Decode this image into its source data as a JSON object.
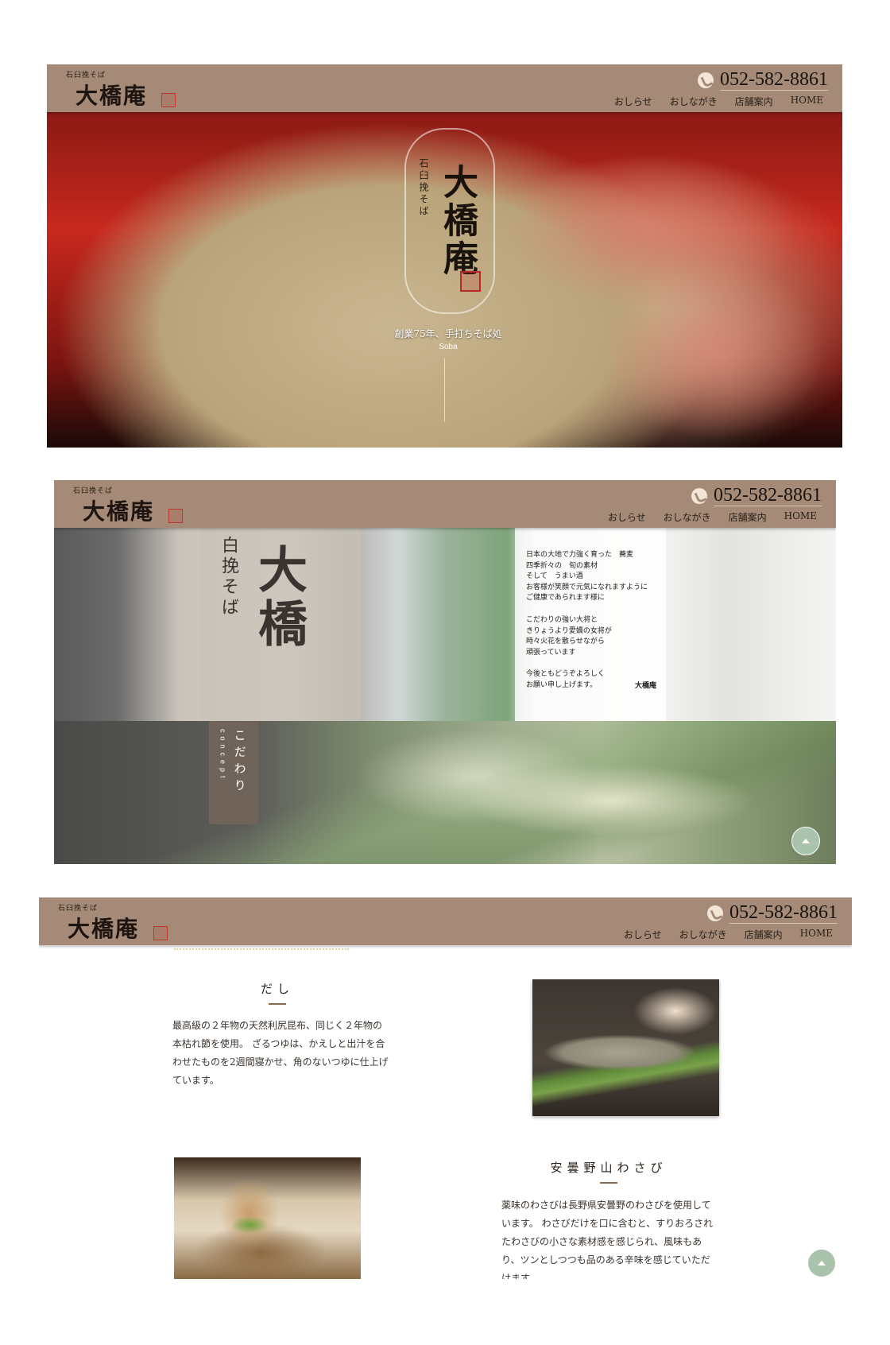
{
  "header": {
    "logo_small": "石臼挽そば",
    "logo_name": "大橋庵",
    "phone": "052-582-8861",
    "nav": [
      "おしらせ",
      "おしながき",
      "店舗案内",
      "HOME"
    ]
  },
  "hero": {
    "crest_sub": "石臼挽そば",
    "crest_name": "大橋庵",
    "tagline": "創業75年、手打ちそば処",
    "soba": "Soba"
  },
  "concept": {
    "sign_small": "白挽そば",
    "sign_big": "大橋",
    "message_paragraphs": [
      "日本の大地で力強く育った　蕎麦\n四季折々の　旬の素材\nそして　うまい酒\nお客様が笑顔で元気になれますように\nご健康であられます様に",
      "こだわりの強い大将と\nきりょうより愛嬌の女将が\n時々火花を散らせながら\n頑張っています",
      "今後ともどうぞよろしく\nお願い申し上げます。"
    ],
    "message_signature": "大橋庵",
    "tab_jp": "こだわり",
    "tab_en": "concept"
  },
  "details": {
    "dashi": {
      "title": "だし",
      "text": "最高級の２年物の天然利尻昆布、同じく２年物の本枯れ節を使用。 ざるつゆは、かえしと出汁を合わせたものを2週間寝かせ、角のないつゆに仕上げています。"
    },
    "wasabi": {
      "title": "安曇野山わさび",
      "text": "薬味のわさびは長野県安曇野のわさびを使用しています。 わさびだけを口に含むと、すりおろされたわさびの小さな素材感を感じられ、風味もあり、ツンとしつつも品のある辛味を感じていただけます。"
    }
  },
  "colors": {
    "header": "#a48a77",
    "accent": "#8a6a4e",
    "to_top": "#a9c3ad"
  },
  "icons": [
    "phone-icon",
    "arrow-up-icon"
  ]
}
